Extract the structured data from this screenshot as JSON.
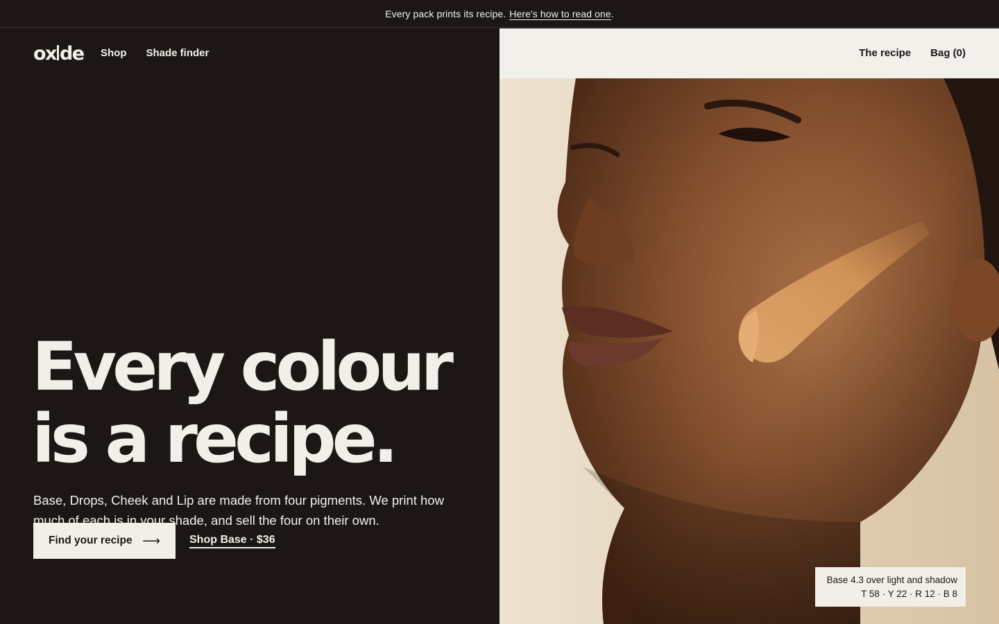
{
  "announcement": {
    "text": "Every pack prints its recipe.",
    "link_text": "Here's how to read one",
    "link_suffix": "."
  },
  "brand": {
    "logo_left": "ox",
    "logo_right": "de"
  },
  "nav": {
    "left": [
      "Shop",
      "Shade finder"
    ],
    "right": [
      "The recipe",
      "Bag (0)"
    ]
  },
  "hero": {
    "headline_line1": "Every colour",
    "headline_line2": "is a recipe.",
    "subcopy": "Base, Drops, Cheek and Lip are made from four pigments. We print how much of each is in your shade, and sell the four on their own.",
    "primary_cta": "Find your recipe",
    "primary_cta_icon": "arrow-right-icon",
    "secondary_cta": "Shop Base · $36"
  },
  "photo_caption": {
    "line1": "Base 4.3 over light and shadow",
    "line2": "T 58 · Y 22 · R 12 · B 8"
  },
  "colors": {
    "dark": "#1c1714",
    "cream": "#f2efe8",
    "swatch": "#d9a165"
  }
}
